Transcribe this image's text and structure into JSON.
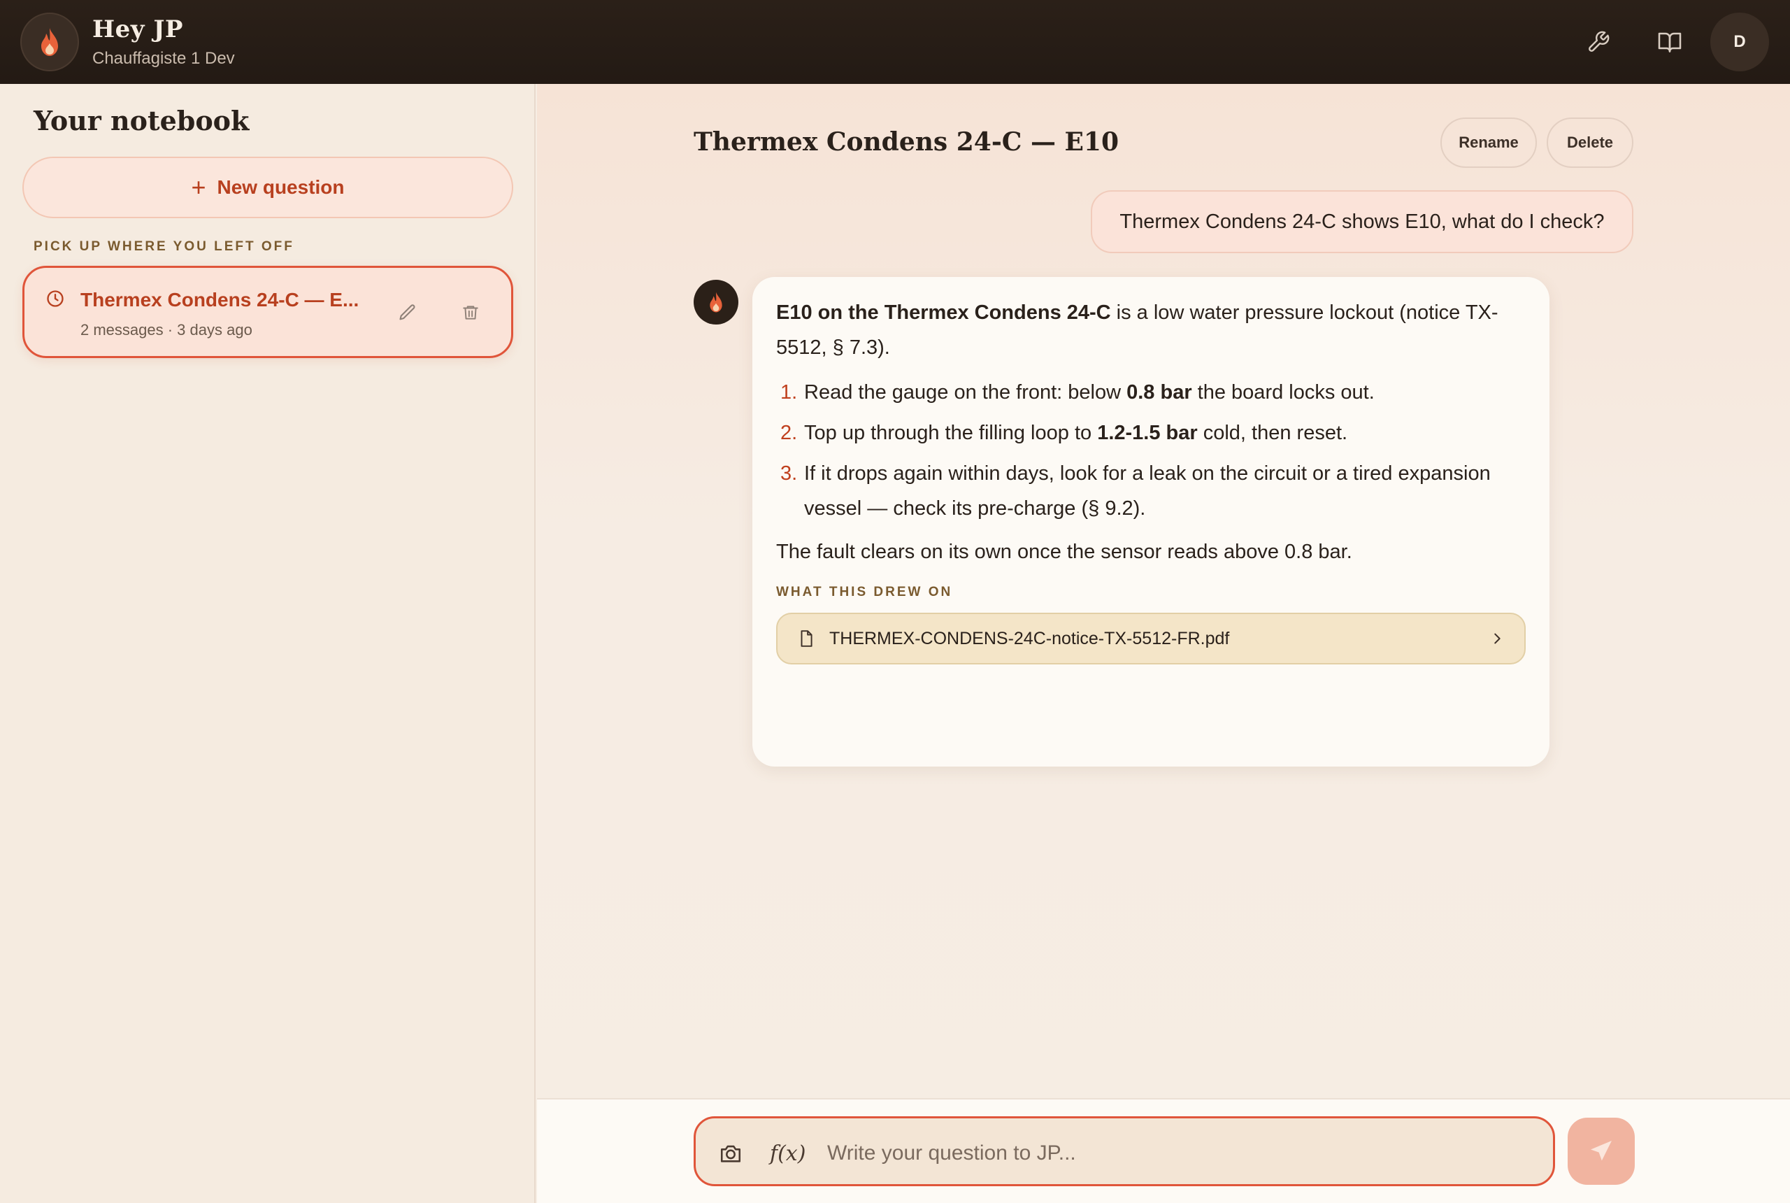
{
  "header": {
    "title": "Hey JP",
    "subtitle": "Chauffagiste 1 Dev",
    "logo_icon": "flame-icon",
    "tools_icon": "wrench-icon",
    "library_icon": "book-icon",
    "avatar_initial": "D"
  },
  "sidebar": {
    "title": "Your notebook",
    "new_question_label": "New question",
    "section_label": "PICK UP WHERE YOU LEFT OFF",
    "conversations": [
      {
        "title": "Thermex Condens 24-C — E...",
        "meta": "2 messages · 3 days ago",
        "icon": "clock-icon",
        "selected": true
      }
    ]
  },
  "conversation": {
    "title": "Thermex Condens 24-C — E10",
    "rename_label": "Rename",
    "delete_label": "Delete",
    "user_message": "Thermex Condens 24-C shows E10, what do I check?",
    "answer": {
      "intro_bold": "E10 on the Thermex Condens 24-C",
      "intro_rest": " is a low water pressure lockout (notice TX-5512, § 7.3).",
      "steps": [
        {
          "num": "1.",
          "pre": "Read the gauge on the front: below ",
          "bold": "0.8 bar",
          "post": " the board locks out."
        },
        {
          "num": "2.",
          "pre": "Top up through the filling loop to ",
          "bold": "1.2-1.5 bar",
          "post": " cold, then reset."
        },
        {
          "num": "3.",
          "pre": "If it drops again within days, look for a leak on the circuit or a tired expansion vessel — check its pre-charge (§ 9.2).",
          "bold": "",
          "post": ""
        }
      ],
      "closing": "The fault clears on its own once the sensor reads above 0.8 bar.",
      "sources_label": "WHAT THIS DREW ON",
      "source_file": "THERMEX-CONDENS-24C-notice-TX-5512-FR.pdf"
    }
  },
  "composer": {
    "placeholder": "Write your question to JP...",
    "fx_label": "f(x)",
    "camera_icon": "camera-icon",
    "send_icon": "send-icon"
  },
  "colors": {
    "accent": "#e0553a",
    "accent_text": "#b8401f",
    "header_bg": "#2b2018",
    "page_bg": "#f6ede3"
  }
}
